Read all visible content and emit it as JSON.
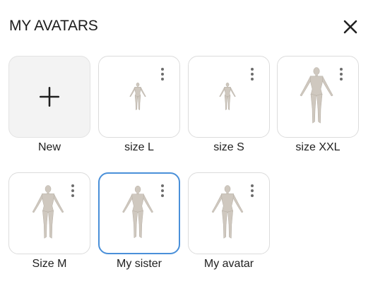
{
  "header": {
    "title": "MY AVATARS",
    "close_icon": "close-icon"
  },
  "tiles": [
    {
      "label": "New",
      "kind": "new",
      "icon": "plus-icon"
    },
    {
      "label": "size L",
      "kind": "avatar",
      "icon": "avatar-figure-icon",
      "menu_icon": "more-vertical-icon"
    },
    {
      "label": "size S",
      "kind": "avatar",
      "icon": "avatar-figure-icon",
      "menu_icon": "more-vertical-icon"
    },
    {
      "label": "size XXL",
      "kind": "avatar",
      "icon": "avatar-figure-icon",
      "menu_icon": "more-vertical-icon"
    },
    {
      "label": "Size M",
      "kind": "avatar",
      "icon": "avatar-figure-icon",
      "menu_icon": "more-vertical-icon"
    },
    {
      "label": "My sister",
      "kind": "avatar",
      "selected": true,
      "icon": "avatar-figure-icon",
      "menu_icon": "more-vertical-icon"
    },
    {
      "label": "My avatar",
      "kind": "avatar",
      "icon": "avatar-figure-icon",
      "menu_icon": "more-vertical-icon"
    }
  ],
  "colors": {
    "selected_border": "#4a90d9",
    "tile_border": "#dcdcdc",
    "new_tile_bg": "#f3f3f3",
    "body_skin": "#cfc8bf"
  }
}
